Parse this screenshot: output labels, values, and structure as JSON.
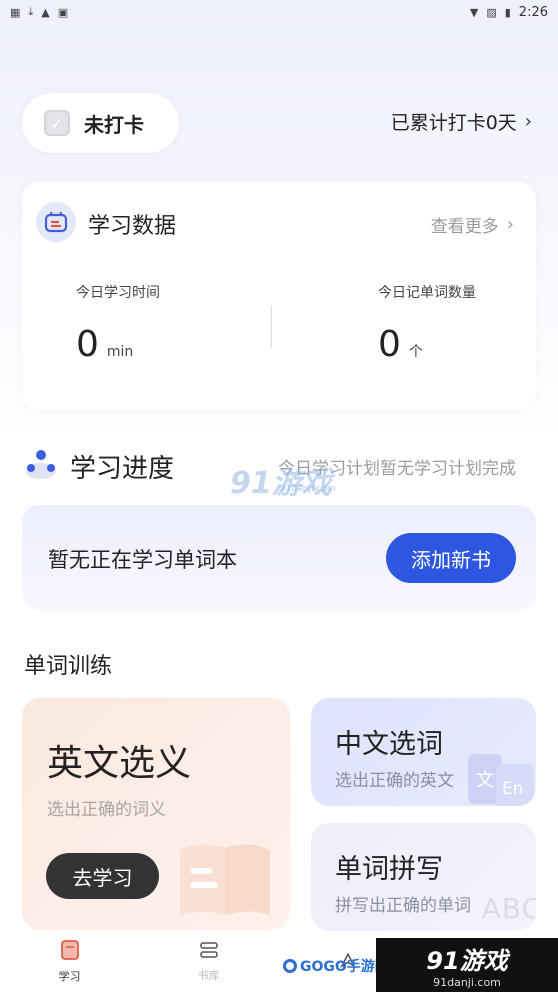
{
  "status_bar": {
    "time": "2:26",
    "left_icons": [
      "notification-icon",
      "download-icon",
      "warning-icon",
      "app-icon"
    ],
    "right_icons": [
      "wifi-icon",
      "no-sim-icon",
      "battery-icon"
    ]
  },
  "checkin": {
    "status_label": "未打卡",
    "total_label": "已累计打卡0天"
  },
  "study_data": {
    "title": "学习数据",
    "see_more": "查看更多",
    "today_time_label": "今日学习时间",
    "today_time_value": "0",
    "today_time_unit": "min",
    "today_words_label": "今日记单词数量",
    "today_words_value": "0",
    "today_words_unit": "个"
  },
  "progress": {
    "title": "学习进度",
    "note": "今日学习计划暂无学习计划完成",
    "empty_text": "暂无正在学习单词本",
    "add_button": "添加新书"
  },
  "training": {
    "heading": "单词训练",
    "english_choice": {
      "title": "英文选义",
      "subtitle": "选出正确的词义",
      "button": "去学习"
    },
    "chinese_choice": {
      "title": "中文选词",
      "subtitle": "选出正确的英文",
      "deco_cn": "文",
      "deco_en": "En"
    },
    "spelling": {
      "title": "单词拼写",
      "subtitle": "拼写出正确的单词",
      "deco": "ABC"
    }
  },
  "bottom_nav": {
    "items": [
      {
        "label": "学习",
        "icon": "book-icon",
        "active": true
      },
      {
        "label": "书库",
        "icon": "library-icon",
        "active": false
      },
      {
        "label": "",
        "icon": "rocket-icon",
        "active": false
      }
    ]
  },
  "watermarks": {
    "logo_91": "91游戏",
    "logo_91_url": "91danji.com",
    "gogo": "GOGO手游网",
    "badge_main": "91游戏",
    "badge_sub": "91danji.com"
  },
  "colors": {
    "accent": "#2d57e0",
    "dark_button": "#333333",
    "muted_text": "#9a9ca5"
  }
}
